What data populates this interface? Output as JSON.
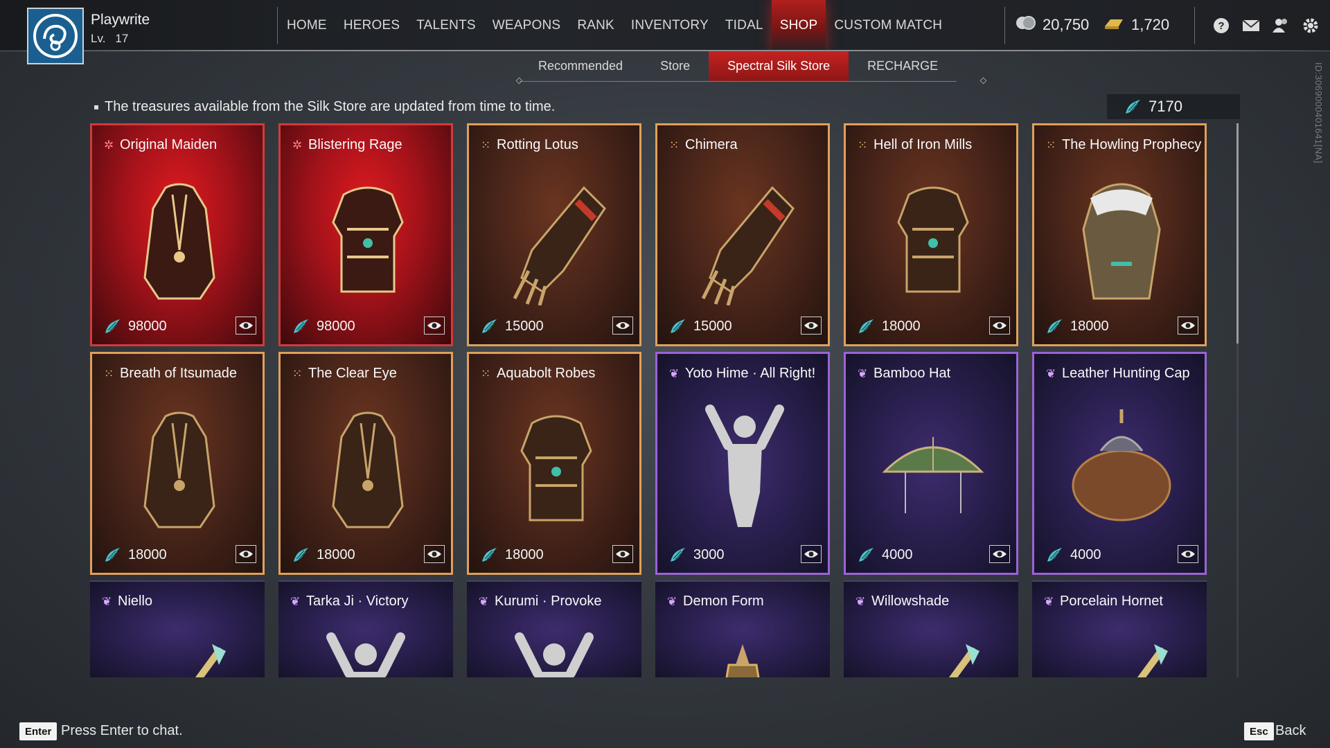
{
  "player": {
    "name": "Playwrite",
    "level_label": "Lv.",
    "level": "17"
  },
  "nav": {
    "items": [
      "HOME",
      "HEROES",
      "TALENTS",
      "WEAPONS",
      "RANK",
      "INVENTORY",
      "TIDAL",
      "SHOP",
      "CUSTOM MATCH"
    ],
    "active": "SHOP"
  },
  "currencies": {
    "gold": "20,750",
    "gold_icon": "coin-stack-icon",
    "ingot": "1,720",
    "ingot_icon": "gold-ingot-icon"
  },
  "top_icons": [
    "help-icon",
    "mail-icon",
    "friends-icon",
    "settings-icon"
  ],
  "subnav": {
    "items": [
      "Recommended",
      "Store",
      "Spectral Silk Store",
      "RECHARGE"
    ],
    "active": "Spectral Silk Store"
  },
  "notice": "The treasures available from the Silk Store are updated from time to time.",
  "silk_balance": "7170",
  "id_tag": "ID:3069000401641[NA]",
  "colors": {
    "accent_red": "#c42220",
    "legendary_red": "#d23a3a",
    "epic_orange": "#e0a05a",
    "rare_purple": "#9a63d6",
    "silk_teal": "#4fc3c9"
  },
  "cards": [
    {
      "name": "Original Maiden",
      "price": "98000",
      "rarity": "red",
      "icon": "outfit"
    },
    {
      "name": "Blistering Rage",
      "price": "98000",
      "rarity": "red",
      "icon": "armor"
    },
    {
      "name": "Rotting Lotus",
      "price": "15000",
      "rarity": "orange",
      "icon": "gauntlet"
    },
    {
      "name": "Chimera",
      "price": "15000",
      "rarity": "orange",
      "icon": "gauntlet"
    },
    {
      "name": "Hell of Iron Mills",
      "price": "18000",
      "rarity": "orange",
      "icon": "armor"
    },
    {
      "name": "The Howling Prophecy",
      "price": "18000",
      "rarity": "orange",
      "icon": "fur-coat"
    },
    {
      "name": "Breath of Itsumade",
      "price": "18000",
      "rarity": "orange",
      "icon": "outfit"
    },
    {
      "name": "The Clear Eye",
      "price": "18000",
      "rarity": "orange",
      "icon": "outfit"
    },
    {
      "name": "Aquabolt Robes",
      "price": "18000",
      "rarity": "orange",
      "icon": "armor"
    },
    {
      "name": "Yoto Hime · All Right!",
      "price": "3000",
      "rarity": "purple",
      "icon": "emote"
    },
    {
      "name": "Bamboo Hat",
      "price": "4000",
      "rarity": "purple",
      "icon": "hat"
    },
    {
      "name": "Leather Hunting Cap",
      "price": "4000",
      "rarity": "purple",
      "icon": "fur-cap"
    },
    {
      "name": "Niello",
      "price": "",
      "rarity": "purple",
      "icon": "weapon"
    },
    {
      "name": "Tarka Ji · Victory",
      "price": "",
      "rarity": "purple",
      "icon": "emote"
    },
    {
      "name": "Kurumi · Provoke",
      "price": "",
      "rarity": "purple",
      "icon": "emote"
    },
    {
      "name": "Demon Form",
      "price": "",
      "rarity": "purple",
      "icon": "lantern"
    },
    {
      "name": "Willowshade",
      "price": "",
      "rarity": "purple",
      "icon": "weapon"
    },
    {
      "name": "Porcelain Hornet",
      "price": "",
      "rarity": "purple",
      "icon": "weapon"
    }
  ],
  "footer": {
    "chat_key": "Enter",
    "chat_text": "Press Enter to chat.",
    "back_key": "Esc",
    "back_text": "Back"
  }
}
